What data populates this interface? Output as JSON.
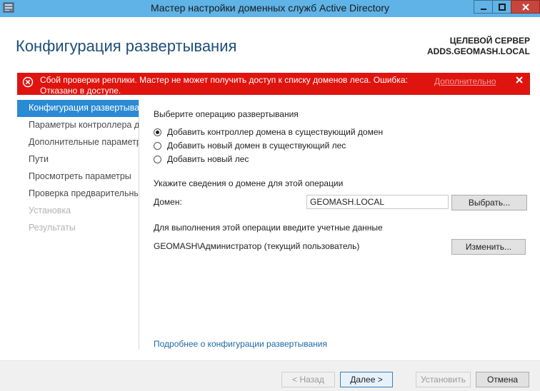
{
  "window": {
    "title": "Мастер настройки доменных служб Active Directory",
    "accent": "#5fb3e6"
  },
  "header": {
    "page_title": "Конфигурация развертывания",
    "target_label": "ЦЕЛЕВОЙ СЕРВЕР",
    "target_server": "ADDS.GEOMASH.LOCAL"
  },
  "error": {
    "message": "Сбой проверки реплики. Мастер не может получить доступ к списку доменов леса. Ошибка: Отказано в доступе.",
    "more_link": "Дополнительно",
    "color": "#e0140f"
  },
  "nav": {
    "items": [
      {
        "label": "Конфигурация развертывания"
      },
      {
        "label": "Параметры контроллера домена"
      },
      {
        "label": "Дополнительные параметры"
      },
      {
        "label": "Пути"
      },
      {
        "label": "Просмотреть параметры"
      },
      {
        "label": "Проверка предварительных требований"
      },
      {
        "label": "Установка"
      },
      {
        "label": "Результаты"
      }
    ],
    "active_color": "#2a8ad4"
  },
  "main": {
    "operation_heading": "Выберите операцию развертывания",
    "options": [
      {
        "label": "Добавить контроллер домена в существующий домен",
        "checked": true
      },
      {
        "label": "Добавить новый домен в существующий лес",
        "checked": false
      },
      {
        "label": "Добавить новый лес",
        "checked": false
      }
    ],
    "domain_section_label": "Укажите сведения о домене для этой операции",
    "domain_label": "Домен:",
    "domain_value": "GEOMASH.LOCAL",
    "select_button": "Выбрать...",
    "credentials_label": "Для выполнения этой операции введите учетные данные",
    "credentials_value": "GEOMASH\\Администратор (текущий пользователь)",
    "change_button": "Изменить...",
    "learn_more": "Подробнее о конфигурации развертывания"
  },
  "footer": {
    "back": "< Назад",
    "next": "Далее >",
    "install": "Установить",
    "cancel": "Отмена"
  }
}
